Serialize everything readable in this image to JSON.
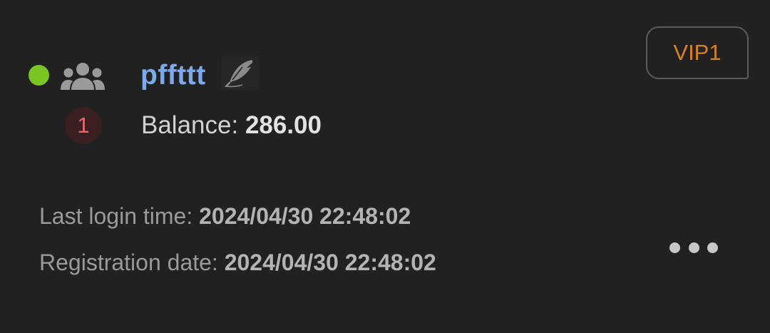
{
  "user": {
    "username": "pffttt",
    "online": true,
    "vip_level": "VIP1",
    "count": "1",
    "balance_label": "Balance: ",
    "balance_value": "286.00"
  },
  "details": {
    "last_login_label": "Last login time: ",
    "last_login_value": "2024/04/30 22:48:02",
    "registration_label": "Registration date: ",
    "registration_value": "2024/04/30 22:48:02"
  },
  "icons": {
    "status": "online-dot",
    "group": "group-icon",
    "edit": "feather-icon",
    "more": "more-icon"
  },
  "colors": {
    "background": "#212121",
    "online": "#7ac425",
    "username": "#7ea9ec",
    "vip": "#d97f27",
    "badge_text": "#e36b6b"
  }
}
